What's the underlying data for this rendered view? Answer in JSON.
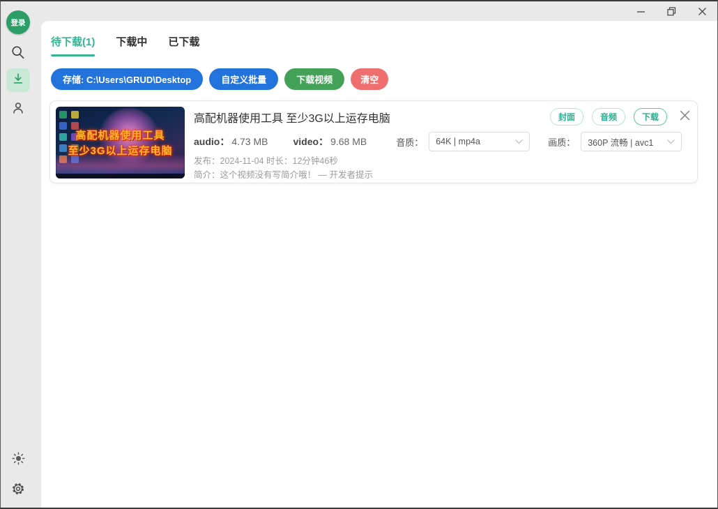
{
  "window": {
    "title_region": "",
    "controls": {
      "minimize": "minimize",
      "restore": "restore",
      "close": "close"
    }
  },
  "sidebar": {
    "login_label": "登录",
    "icons": [
      "search-icon",
      "download-icon",
      "user-icon",
      "brightness-icon",
      "gear-icon"
    ]
  },
  "tabs": [
    {
      "label": "待下载(1)",
      "active": true
    },
    {
      "label": "下载中",
      "active": false
    },
    {
      "label": "已下载",
      "active": false
    }
  ],
  "toolbar": {
    "storage_label": "存储: C:\\Users\\GRUD\\Desktop",
    "custom_batch_label": "自定义批量",
    "download_video_label": "下载视频",
    "clear_label": "清空"
  },
  "card": {
    "title": "高配机器使用工具 至少3G以上运存电脑",
    "thumbnail": {
      "line1": "高配机器使用工具",
      "line2": "至少3G以上运存电脑"
    },
    "audio_label": "audio：",
    "audio_size": "4.73 MB",
    "video_label": "video：",
    "video_size": "9.68 MB",
    "audio_quality_label": "音质：",
    "audio_quality_value": "64K | mp4a",
    "video_quality_label": "画质：",
    "video_quality_value": "360P 流畅 | avc1",
    "publish_info": "发布：2024-11-04 时长：12分钟46秒",
    "desc_info": "简介：这个视频没有写简介哦！ — 开发者提示",
    "actions": [
      {
        "label": "封面"
      },
      {
        "label": "音频"
      },
      {
        "label": "下载"
      }
    ]
  },
  "colors": {
    "accent_teal": "#35b392",
    "primary_blue": "#2273dc",
    "success_green": "#43a158",
    "danger_red": "#ee6f6e",
    "login_green": "#2b9e68",
    "sidebar_bg": "#e9e9e9"
  }
}
